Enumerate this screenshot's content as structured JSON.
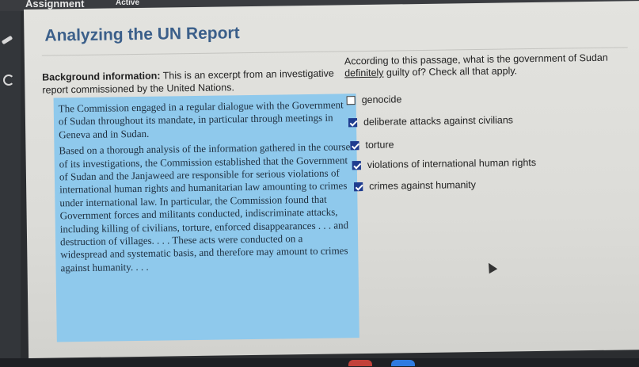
{
  "window": {
    "title": "Assignment",
    "status": "Active"
  },
  "lesson": {
    "title": "Analyzing the UN Report"
  },
  "background": {
    "label": "Background information:",
    "text": "This is an excerpt from an investigative report commissioned by the United Nations."
  },
  "passage": {
    "paragraphs": [
      "The Commission engaged in a regular dialogue with the Government of Sudan throughout its mandate, in particular through meetings in Geneva and in Sudan.",
      "Based on a thorough analysis of the information gathered in the course of its investigations, the Commission established that the Government of Sudan and the Janjaweed are responsible for serious violations of international human rights and humanitarian law amounting to crimes under international law. In particular, the Commission found that Government forces and militants conducted, indiscriminate attacks, including killing of civilians, torture, enforced disappearances . . . and destruction of villages. . . . These acts were conducted on a widespread and systematic basis, and therefore may amount to crimes against humanity. . . ."
    ]
  },
  "question": {
    "text_before": "According to this passage, what is the government of Sudan ",
    "emphasis": "definitely",
    "text_after": " guilty of? Check all that apply."
  },
  "options": [
    {
      "label": "genocide",
      "checked": false
    },
    {
      "label": "deliberate attacks against civilians",
      "checked": true
    },
    {
      "label": "torture",
      "checked": true
    },
    {
      "label": "violations of international human rights",
      "checked": true
    },
    {
      "label": "crimes against humanity",
      "checked": true
    }
  ],
  "colors": {
    "title": "#3b5f8a",
    "passage_bg": "#8fc9ec",
    "checkbox_checked": "#1f3c8f"
  }
}
